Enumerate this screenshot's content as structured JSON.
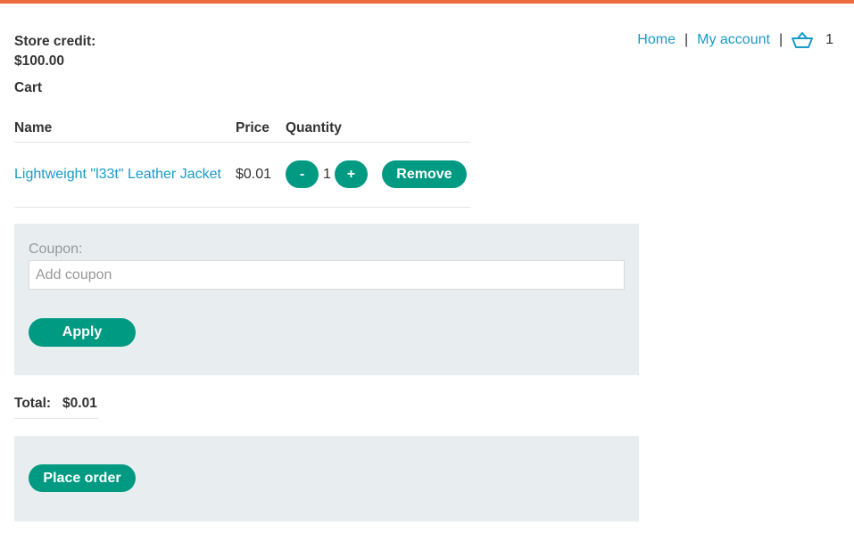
{
  "store_credit": {
    "label": "Store credit:",
    "amount": "$100.00"
  },
  "nav": {
    "home": "Home",
    "separator": "|",
    "account": "My account",
    "cart_icon": "basket-icon",
    "cart_count": "1"
  },
  "cart": {
    "heading": "Cart",
    "columns": [
      "Name",
      "Price",
      "Quantity"
    ],
    "items": [
      {
        "name": "Lightweight \"l33t\" Leather Jacket",
        "price": "$0.01",
        "qty": "1",
        "dec": "-",
        "inc": "+",
        "remove": "Remove"
      }
    ]
  },
  "coupon": {
    "label": "Coupon:",
    "placeholder": "Add coupon",
    "apply": "Apply"
  },
  "total": {
    "label": "Total:",
    "amount": "$0.01"
  },
  "order": {
    "place_order": "Place order"
  },
  "colors": {
    "accent": "#009a82",
    "link": "#1a9bc7",
    "topbar": "#ee6b3b",
    "panel": "#e8eef0"
  }
}
